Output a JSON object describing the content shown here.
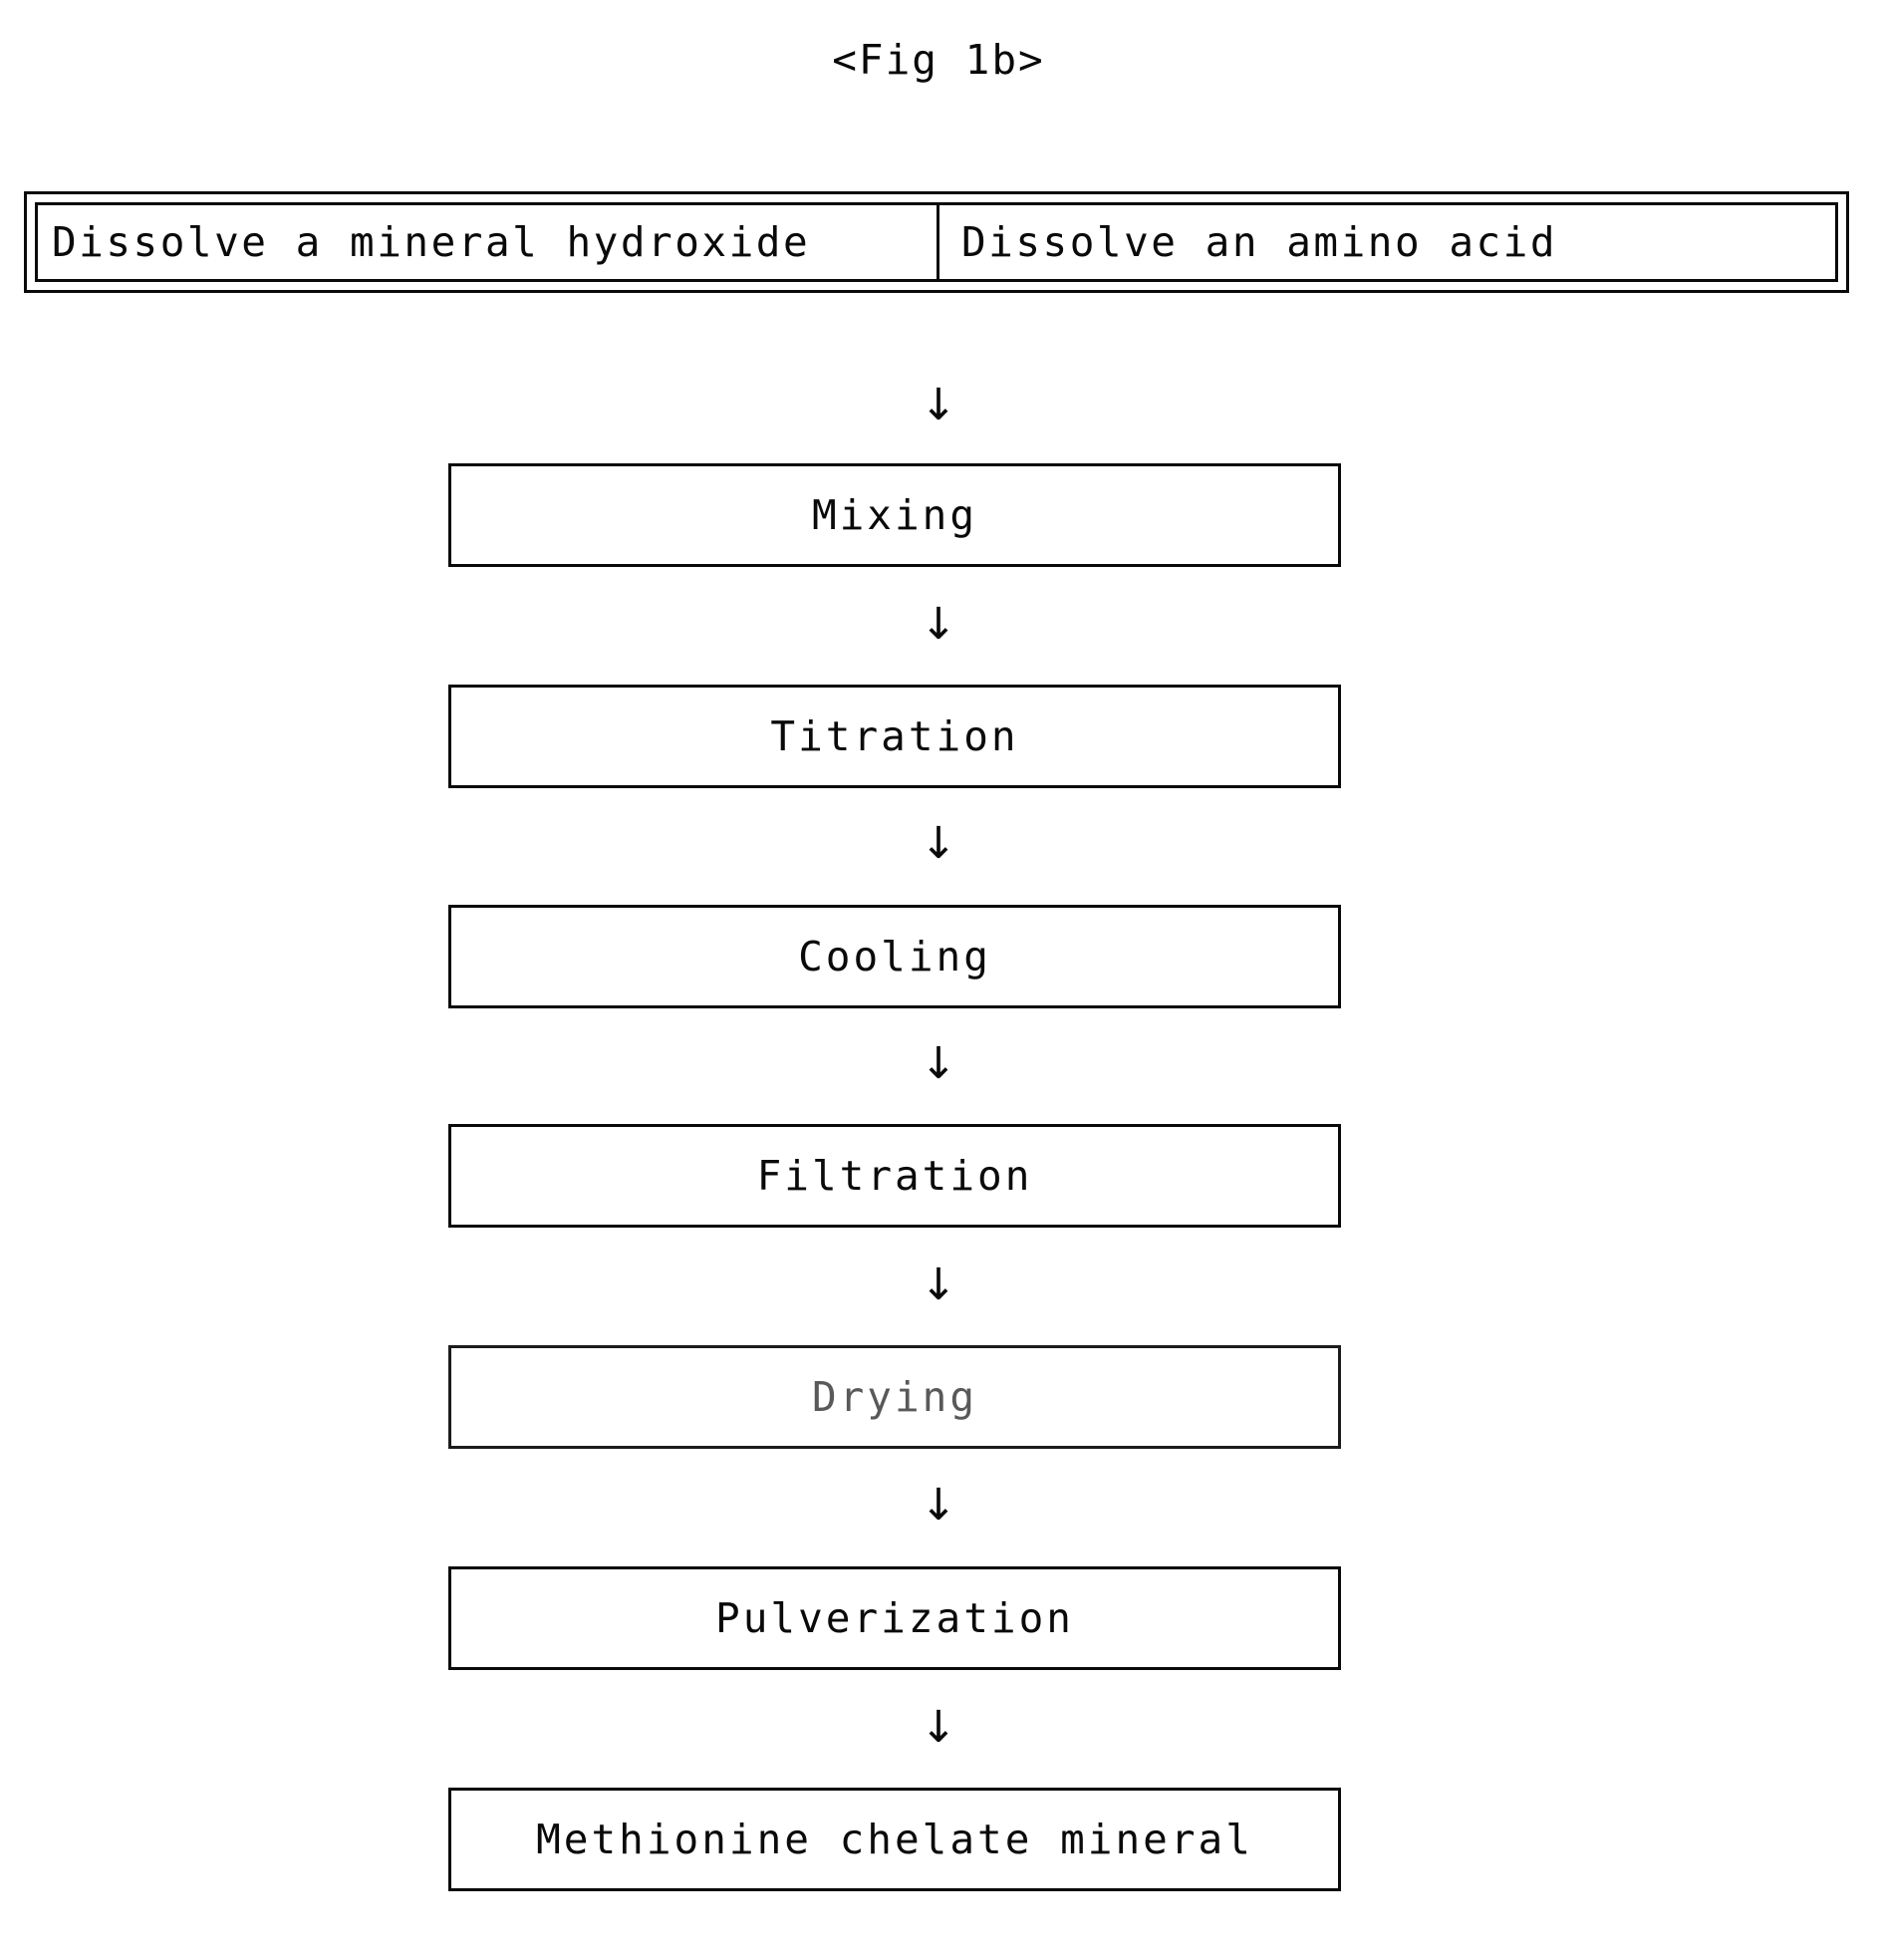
{
  "figure": {
    "title": "<Fig 1b>",
    "arrow_glyph": "↓",
    "ink_color": "#0a0a0a",
    "background_color": "#ffffff"
  },
  "top_row": {
    "left_box_label": "Dissolve a mineral hydroxide",
    "right_box_label": "Dissolve an amino acid"
  },
  "steps": [
    {
      "label": "Mixing"
    },
    {
      "label": "Titration"
    },
    {
      "label": "Cooling"
    },
    {
      "label": "Filtration"
    },
    {
      "label": "Drying"
    },
    {
      "label": "Pulverization"
    },
    {
      "label": "Methionine chelate mineral"
    }
  ],
  "arrows": [
    {
      "from": "Dissolve a mineral hydroxide / Dissolve an amino acid",
      "to": "Mixing",
      "glyph": "↓"
    },
    {
      "from": "Mixing",
      "to": "Titration",
      "glyph": "↓"
    },
    {
      "from": "Titration",
      "to": "Cooling",
      "glyph": "↓"
    },
    {
      "from": "Cooling",
      "to": "Filtration",
      "glyph": "↓"
    },
    {
      "from": "Filtration",
      "to": "Drying",
      "glyph": "↓"
    },
    {
      "from": "Drying",
      "to": "Pulverization",
      "glyph": "↓"
    },
    {
      "from": "Pulverization",
      "to": "Methionine chelate mineral",
      "glyph": "↓"
    }
  ]
}
